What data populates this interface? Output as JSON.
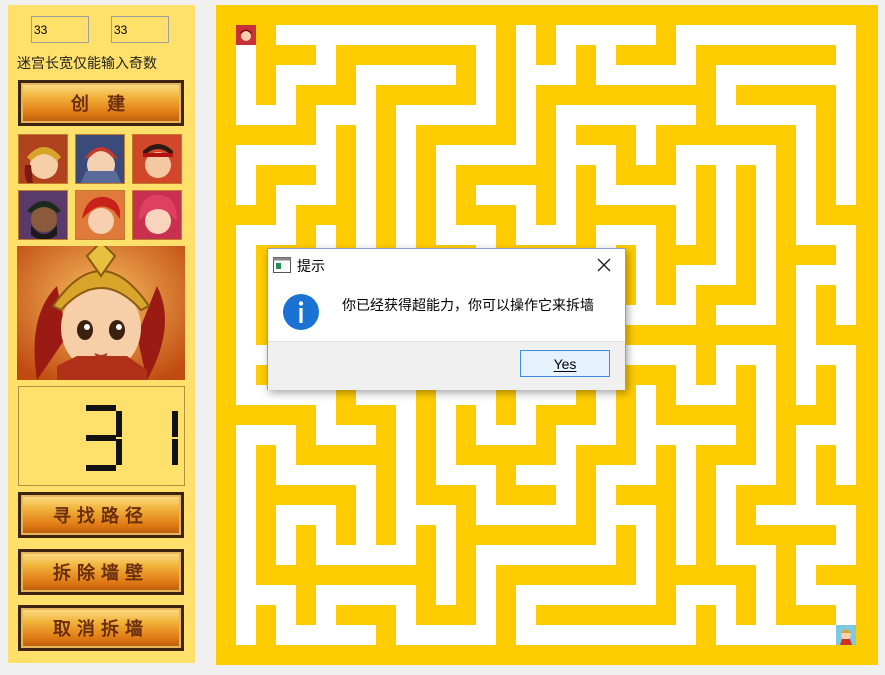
{
  "inputs": {
    "width_value": "33",
    "height_value": "33"
  },
  "hint": "迷宫长宽仅能输入奇数",
  "buttons": {
    "create": "创 建",
    "find_path": "寻找路径",
    "remove_wall": "拆除墙壁",
    "cancel_remove": "取消拆墙"
  },
  "counter": {
    "value": "31"
  },
  "dialog": {
    "title": "提示",
    "message": "你已经获得超能力，你可以操作它来拆墙",
    "yes_label": "Yes"
  },
  "colors": {
    "panel": "#ffe06a",
    "maze_wall": "#ffcc00",
    "maze_path": "#ffffff"
  },
  "icons": {
    "info": "info-icon",
    "close": "close-icon",
    "app": "app-icon"
  }
}
